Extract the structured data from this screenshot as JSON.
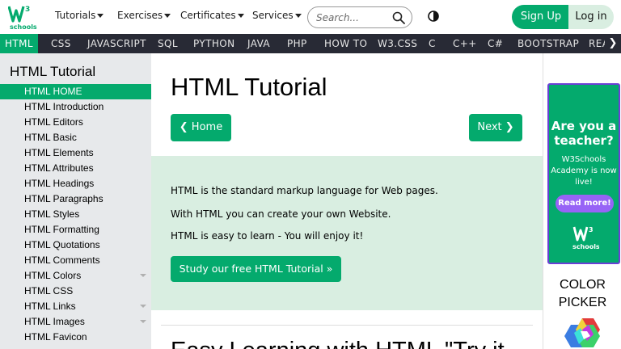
{
  "topbar": {
    "logo_text": "schools",
    "logo_sup": "3",
    "nav": [
      "Tutorials",
      "Exercises",
      "Certificates",
      "Services"
    ],
    "search_placeholder": "Search...",
    "signup": "Sign Up",
    "login": "Log in"
  },
  "subjects": [
    "HTML",
    "CSS",
    "JAVASCRIPT",
    "SQL",
    "PYTHON",
    "JAVA",
    "PHP",
    "HOW TO",
    "W3.CSS",
    "C",
    "C++",
    "C#",
    "BOOTSTRAP",
    "REA"
  ],
  "sidebar": {
    "title": "HTML Tutorial",
    "items": [
      "HTML HOME",
      "HTML Introduction",
      "HTML Editors",
      "HTML Basic",
      "HTML Elements",
      "HTML Attributes",
      "HTML Headings",
      "HTML Paragraphs",
      "HTML Styles",
      "HTML Formatting",
      "HTML Quotations",
      "HTML Comments",
      "HTML Colors",
      "HTML CSS",
      "HTML Links",
      "HTML Images",
      "HTML Favicon"
    ]
  },
  "main": {
    "title": "HTML Tutorial",
    "home_btn": "❮ Home",
    "next_btn": "Next ❯",
    "intro": [
      "HTML is the standard markup language for Web pages.",
      "With HTML you can create your own Website.",
      "HTML is easy to learn - You will enjoy it!"
    ],
    "study_btn": "Study our free HTML Tutorial »",
    "next_heading": "Easy Learning with HTML \"Try it"
  },
  "ad": {
    "headline": "Are you a teacher?",
    "sub": "W3Schools Academy is now live!",
    "button": "Read more!",
    "logo_text": "schools",
    "logo_sup": "3"
  },
  "picker": {
    "label": "COLOR PICKER"
  },
  "colors": {
    "accent": "#04aa6d",
    "dark_bar": "#282a35",
    "sidebar_bg": "#e7e9eb",
    "intro_bg": "#d9eee1",
    "ad_border": "#6b3fd6",
    "ad_button": "#9763f6"
  }
}
